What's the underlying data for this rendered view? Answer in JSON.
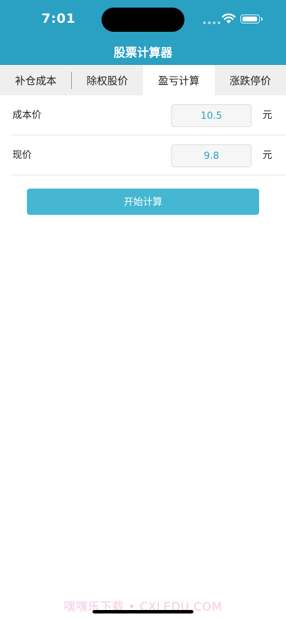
{
  "status_bar": {
    "time": "7:01"
  },
  "header": {
    "title": "股票计算器"
  },
  "tabs": [
    {
      "label": "补仓成本",
      "active": false
    },
    {
      "label": "除权股价",
      "active": false
    },
    {
      "label": "盈亏计算",
      "active": true
    },
    {
      "label": "涨跌停价",
      "active": false
    }
  ],
  "form": {
    "cost_price": {
      "label": "成本价",
      "value": "10.5",
      "unit": "元"
    },
    "current_price": {
      "label": "现价",
      "value": "9.8",
      "unit": "元"
    }
  },
  "actions": {
    "calculate_label": "开始计算"
  },
  "watermark": "嘿嘿乐下载 • CXLEDU.COM",
  "colors": {
    "accent": "#2aa0c3",
    "button": "#45b7d2"
  }
}
